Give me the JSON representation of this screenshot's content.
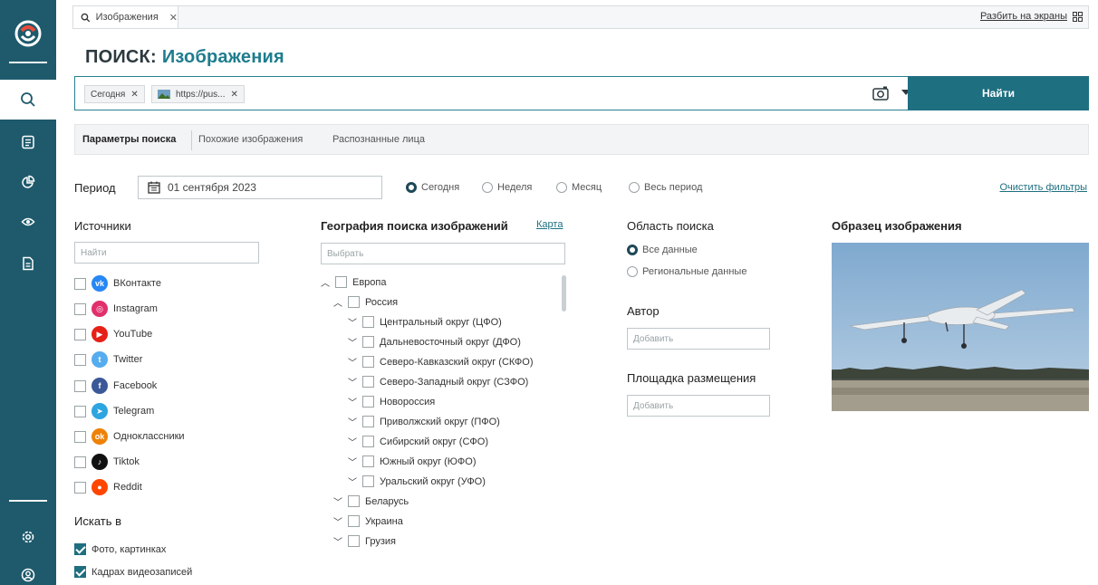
{
  "tabs": [
    {
      "label": "Изображения"
    }
  ],
  "tabbar": {
    "split_label": "Разбить на экраны"
  },
  "title": {
    "prefix": "ПОИСК:",
    "section": "Изображения"
  },
  "search": {
    "chips": [
      {
        "label": "Сегодня"
      },
      {
        "label": "https://pus..."
      }
    ],
    "find_label": "Найти"
  },
  "subtabs": [
    {
      "label": "Параметры поиска"
    },
    {
      "label": "Похожие изображения"
    },
    {
      "label": "Распознанные лица"
    }
  ],
  "period": {
    "label": "Период",
    "date": "01 сентября 2023",
    "options": [
      {
        "label": "Сегодня",
        "selected": true
      },
      {
        "label": "Неделя",
        "selected": false
      },
      {
        "label": "Месяц",
        "selected": false
      },
      {
        "label": "Весь период",
        "selected": false
      }
    ],
    "clear_label": "Очистить фильтры"
  },
  "sources": {
    "title": "Источники",
    "placeholder": "Найти",
    "items": [
      {
        "label": "ВКонтакте",
        "color": "#2787f5",
        "icon": "vk-icon"
      },
      {
        "label": "Instagram",
        "color": "#e1306c",
        "icon": "instagram-icon"
      },
      {
        "label": "YouTube",
        "color": "#e62117",
        "icon": "youtube-icon"
      },
      {
        "label": "Twitter",
        "color": "#55acee",
        "icon": "twitter-icon"
      },
      {
        "label": "Facebook",
        "color": "#3b5998",
        "icon": "facebook-icon"
      },
      {
        "label": "Telegram",
        "color": "#2ca5e0",
        "icon": "telegram-icon"
      },
      {
        "label": "Одноклассники",
        "color": "#ee8208",
        "icon": "odnoklassniki-icon"
      },
      {
        "label": "Tiktok",
        "color": "#111111",
        "icon": "tiktok-icon"
      },
      {
        "label": "Reddit",
        "color": "#ff4500",
        "icon": "reddit-icon"
      }
    ]
  },
  "search_in": {
    "title": "Искать в",
    "items": [
      {
        "label": "Фото, картинках",
        "checked": true
      },
      {
        "label": "Кадрах видеозаписей",
        "checked": true
      }
    ]
  },
  "geo": {
    "title": "География поиска изображений",
    "map_label": "Карта",
    "placeholder": "Выбрать",
    "items": [
      {
        "label": "Европа",
        "expanded": true
      },
      {
        "label": "Россия",
        "expanded": true
      },
      {
        "label": "Центральный округ (ЦФО)",
        "expanded": false
      },
      {
        "label": "Дальневосточный округ (ДФО)",
        "expanded": false
      },
      {
        "label": "Северо-Кавказский округ (СКФО)",
        "expanded": false
      },
      {
        "label": "Северо-Западный округ (СЗФО)",
        "expanded": false
      },
      {
        "label": "Новороссия",
        "expanded": false
      },
      {
        "label": "Приволжский округ (ПФО)",
        "expanded": false
      },
      {
        "label": "Сибирский округ (СФО)",
        "expanded": false
      },
      {
        "label": "Южный округ (ЮФО)",
        "expanded": false
      },
      {
        "label": "Уральский округ (УФО)",
        "expanded": false
      },
      {
        "label": "Беларусь",
        "expanded": false
      },
      {
        "label": "Украина",
        "expanded": false
      },
      {
        "label": "Грузия",
        "expanded": false
      }
    ]
  },
  "area": {
    "title": "Область поиска",
    "options": [
      {
        "label": "Все данные",
        "selected": true
      },
      {
        "label": "Региональные данные",
        "selected": false
      }
    ],
    "author_title": "Автор",
    "author_placeholder": "Добавить",
    "platform_title": "Площадка размещения",
    "platform_placeholder": "Добавить"
  },
  "sample": {
    "title": "Образец изображения"
  },
  "colors": {
    "sidebar": "#1e5a6c",
    "accent": "#1e6f80",
    "button": "#1e6f80"
  }
}
